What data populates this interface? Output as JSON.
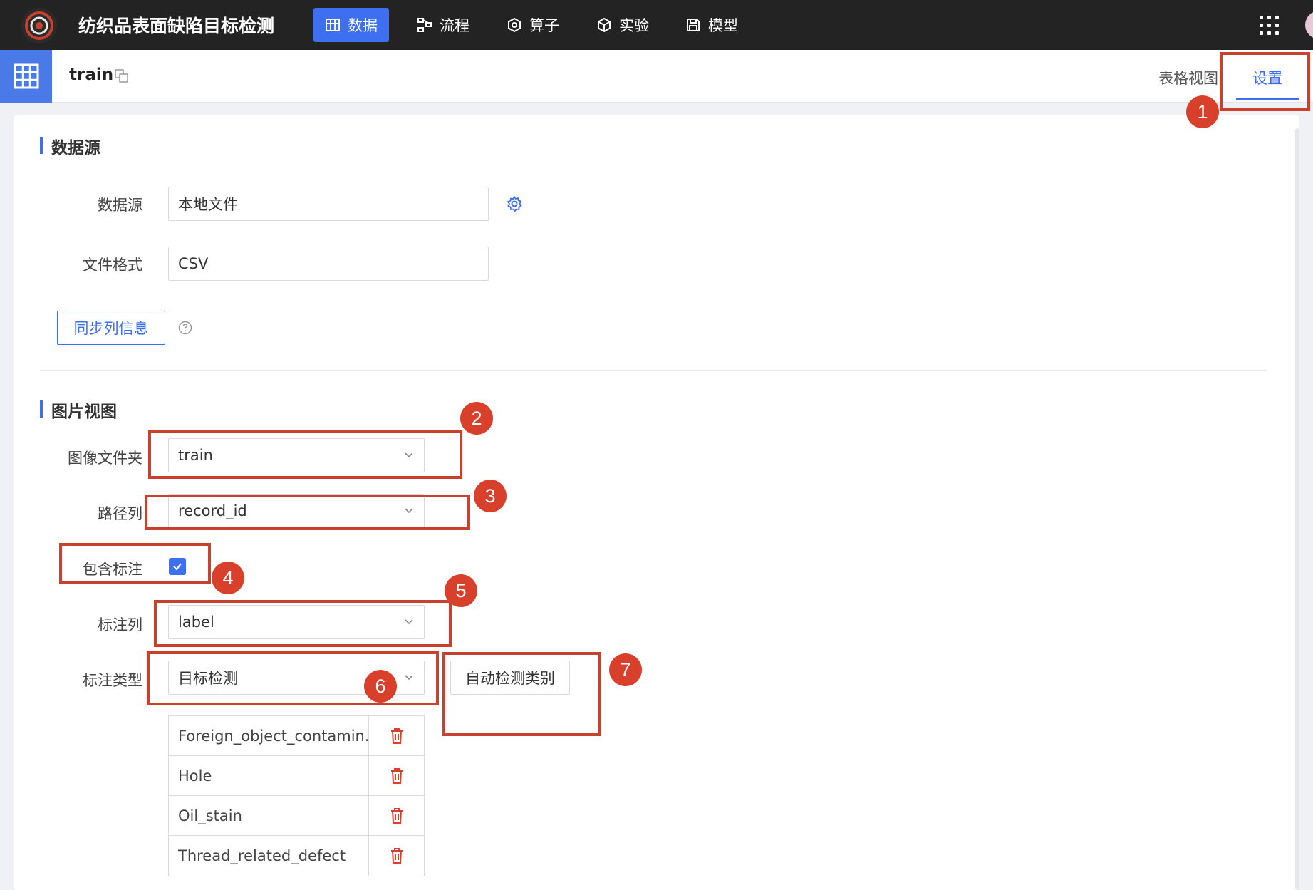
{
  "app": {
    "title": "纺织品表面缺陷目标检测"
  },
  "nav": [
    {
      "label": "数据",
      "icon": "table-icon",
      "active": true
    },
    {
      "label": "流程",
      "icon": "flow-icon",
      "active": false
    },
    {
      "label": "算子",
      "icon": "hexagon-icon",
      "active": false
    },
    {
      "label": "实验",
      "icon": "cube-icon",
      "active": false
    },
    {
      "label": "模型",
      "icon": "save-icon",
      "active": false
    }
  ],
  "dataset": {
    "name": "train"
  },
  "tabs": {
    "table_view": "表格视图",
    "settings": "设置"
  },
  "source_section": {
    "title": "数据源",
    "source_label": "数据源",
    "source_value": "本地文件",
    "format_label": "文件格式",
    "format_value": "CSV",
    "sync_button": "同步列信息"
  },
  "image_section": {
    "title": "图片视图",
    "folder_label": "图像文件夹",
    "folder_value": "train",
    "path_label": "路径列",
    "path_value": "record_id",
    "include_label": "包含标注",
    "include_checked": true,
    "label_col_label": "标注列",
    "label_col_value": "label",
    "label_type_label": "标注类型",
    "label_type_value": "目标检测",
    "auto_detect_button": "自动检测类别",
    "classes": [
      "Foreign_object_contamin...",
      "Hole",
      "Oil_stain",
      "Thread_related_defect"
    ]
  },
  "annotations": [
    "1",
    "2",
    "3",
    "4",
    "5",
    "6",
    "7"
  ],
  "colors": {
    "accent": "#3d6ff0",
    "topbar": "#232323",
    "annotation": "#d9402c",
    "delete": "#d9402c"
  }
}
